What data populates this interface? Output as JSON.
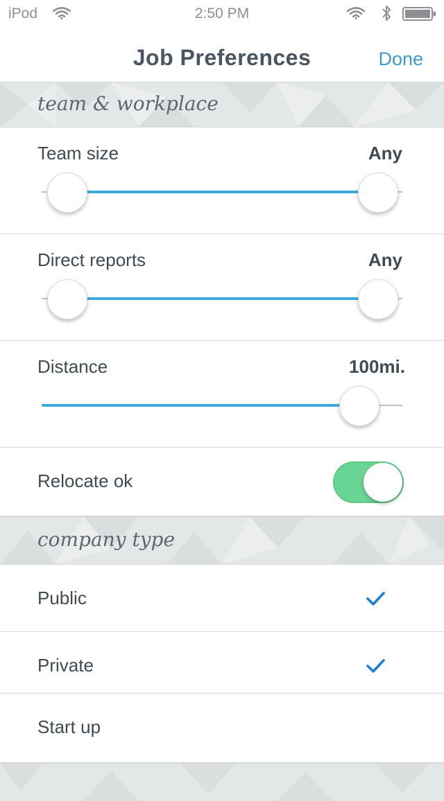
{
  "status_bar": {
    "carrier": "iPod",
    "time": "2:50 PM",
    "icons": [
      "wifi-icon",
      "bluetooth-icon",
      "battery-icon"
    ]
  },
  "nav": {
    "title": "Job Preferences",
    "done_label": "Done"
  },
  "sections": {
    "team_workplace": {
      "header": "team & workplace"
    },
    "company_type": {
      "header": "company type"
    }
  },
  "preferences": {
    "team_size": {
      "label": "Team size",
      "value": "Any",
      "range_fraction": [
        0,
        1
      ]
    },
    "direct_reports": {
      "label": "Direct reports",
      "value": "Any",
      "range_fraction": [
        0,
        1
      ]
    },
    "distance": {
      "label": "Distance",
      "value": "100mi.",
      "level_fraction": 0.94
    },
    "relocate": {
      "label": "Relocate ok",
      "on": true
    }
  },
  "company_types": [
    {
      "label": "Public",
      "checked": true
    },
    {
      "label": "Private",
      "checked": true
    },
    {
      "label": "Start up",
      "checked": false
    }
  ],
  "colors": {
    "accent": "#3d9ad1",
    "slider_fill": "#3fa8dc",
    "toggle_on": "#6ad696",
    "check": "#1a7fe0"
  }
}
